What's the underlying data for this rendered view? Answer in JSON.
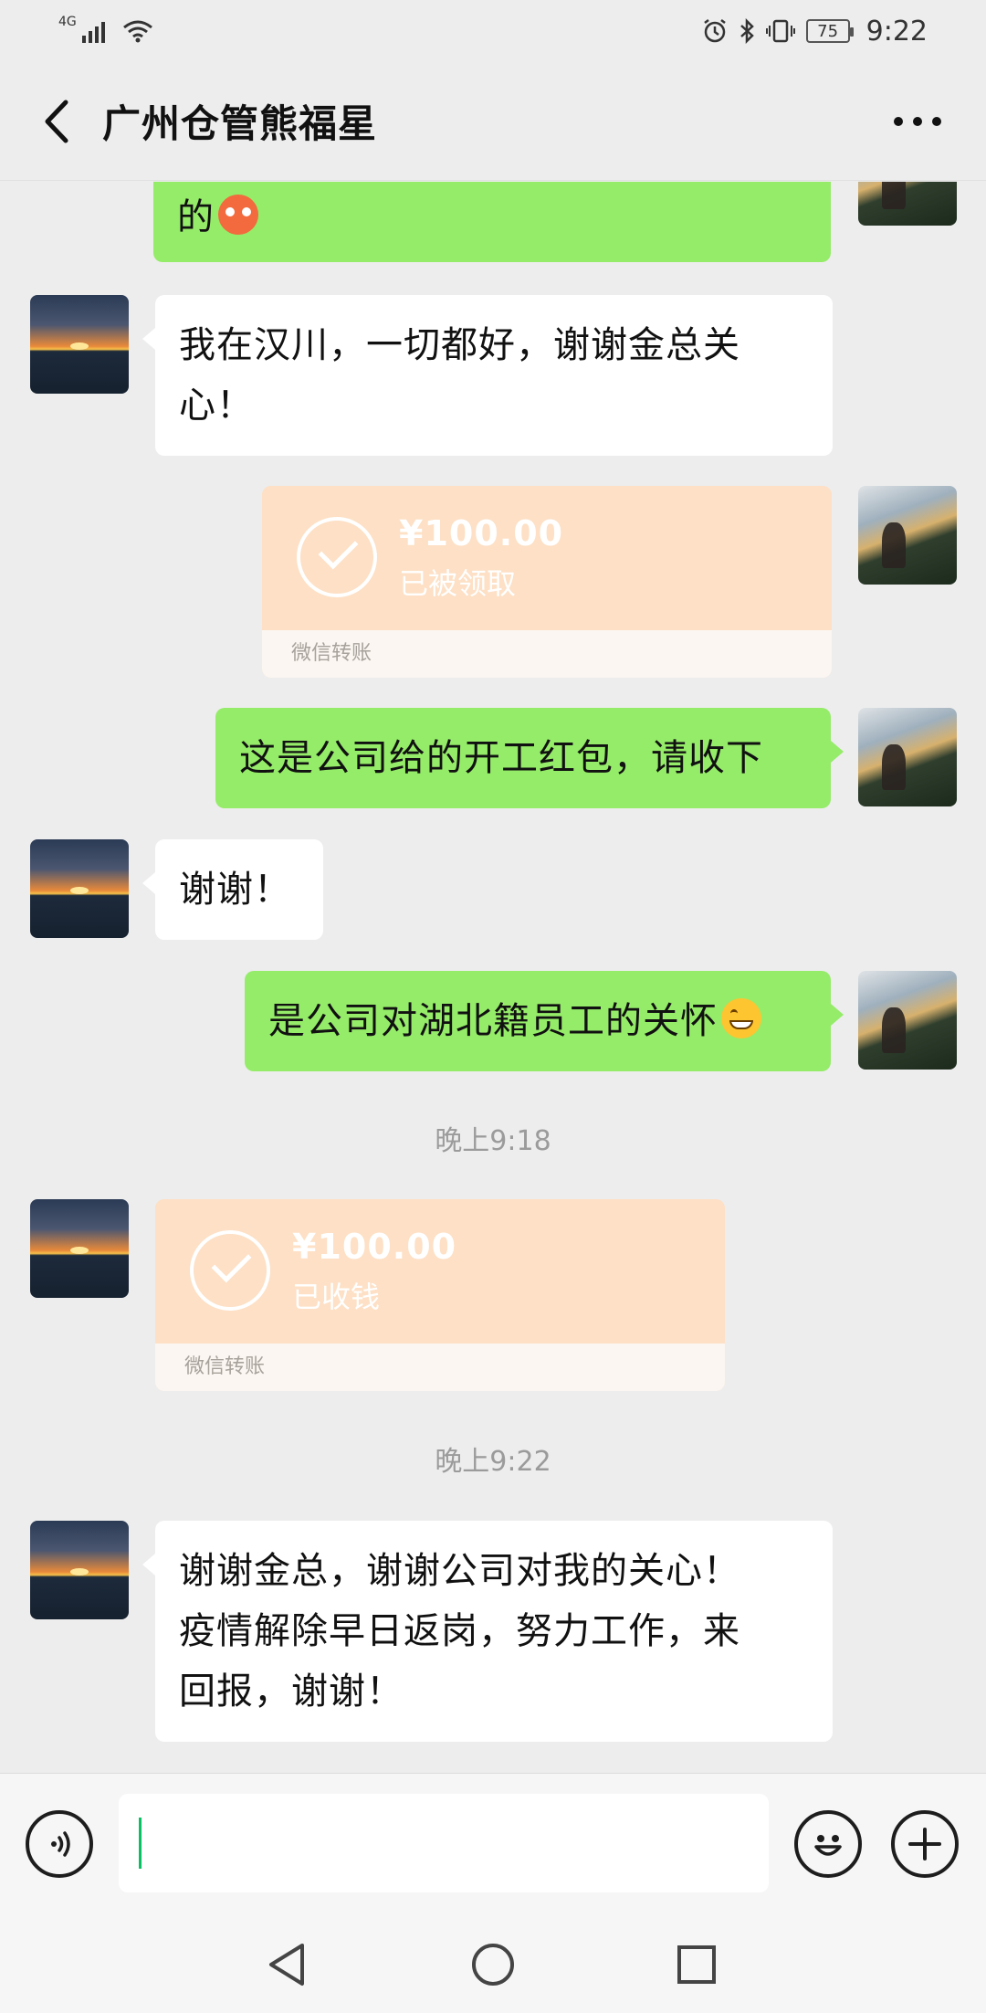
{
  "status_bar": {
    "network_label": "4G",
    "battery": "75",
    "time": "9:22"
  },
  "header": {
    "title": "广州仓管熊福星"
  },
  "messages": [
    {
      "side": "right",
      "text": "的"
    },
    {
      "side": "left",
      "line1": "我在汉川，一切都好，谢谢金总关",
      "line2": "心！"
    },
    {
      "side": "right",
      "type": "transfer",
      "amount": "¥100.00",
      "status": "已被领取",
      "footer": "微信转账"
    },
    {
      "side": "right",
      "text": "这是公司给的开工红包，请收下"
    },
    {
      "side": "left",
      "text": "谢谢！"
    },
    {
      "side": "right",
      "text": "是公司对湖北籍员工的关怀"
    },
    {
      "type": "time",
      "text": "晚上9:18"
    },
    {
      "side": "left",
      "type": "transfer",
      "amount": "¥100.00",
      "status": "已收钱",
      "footer": "微信转账"
    },
    {
      "type": "time",
      "text": "晚上9:22"
    },
    {
      "side": "left",
      "line1": "谢谢金总，谢谢公司对我的关心！",
      "line2": "疫情解除早日返岗，努力工作，来",
      "line3": "回报，谢谢！"
    }
  ],
  "input": {
    "value": ""
  },
  "colors": {
    "background": "#ededed",
    "own_bubble": "#95ec69",
    "other_bubble": "#ffffff",
    "transfer": "#fde0c5",
    "cursor": "#08c160"
  },
  "icons": {
    "back": "chevron-left-icon",
    "more": "more-dots-icon",
    "voice": "voice-icon",
    "emoji": "emoji-face-icon",
    "plus": "plus-icon",
    "nav_back": "triangle-back-icon",
    "nav_home": "circle-home-icon",
    "nav_recent": "square-recent-icon"
  }
}
